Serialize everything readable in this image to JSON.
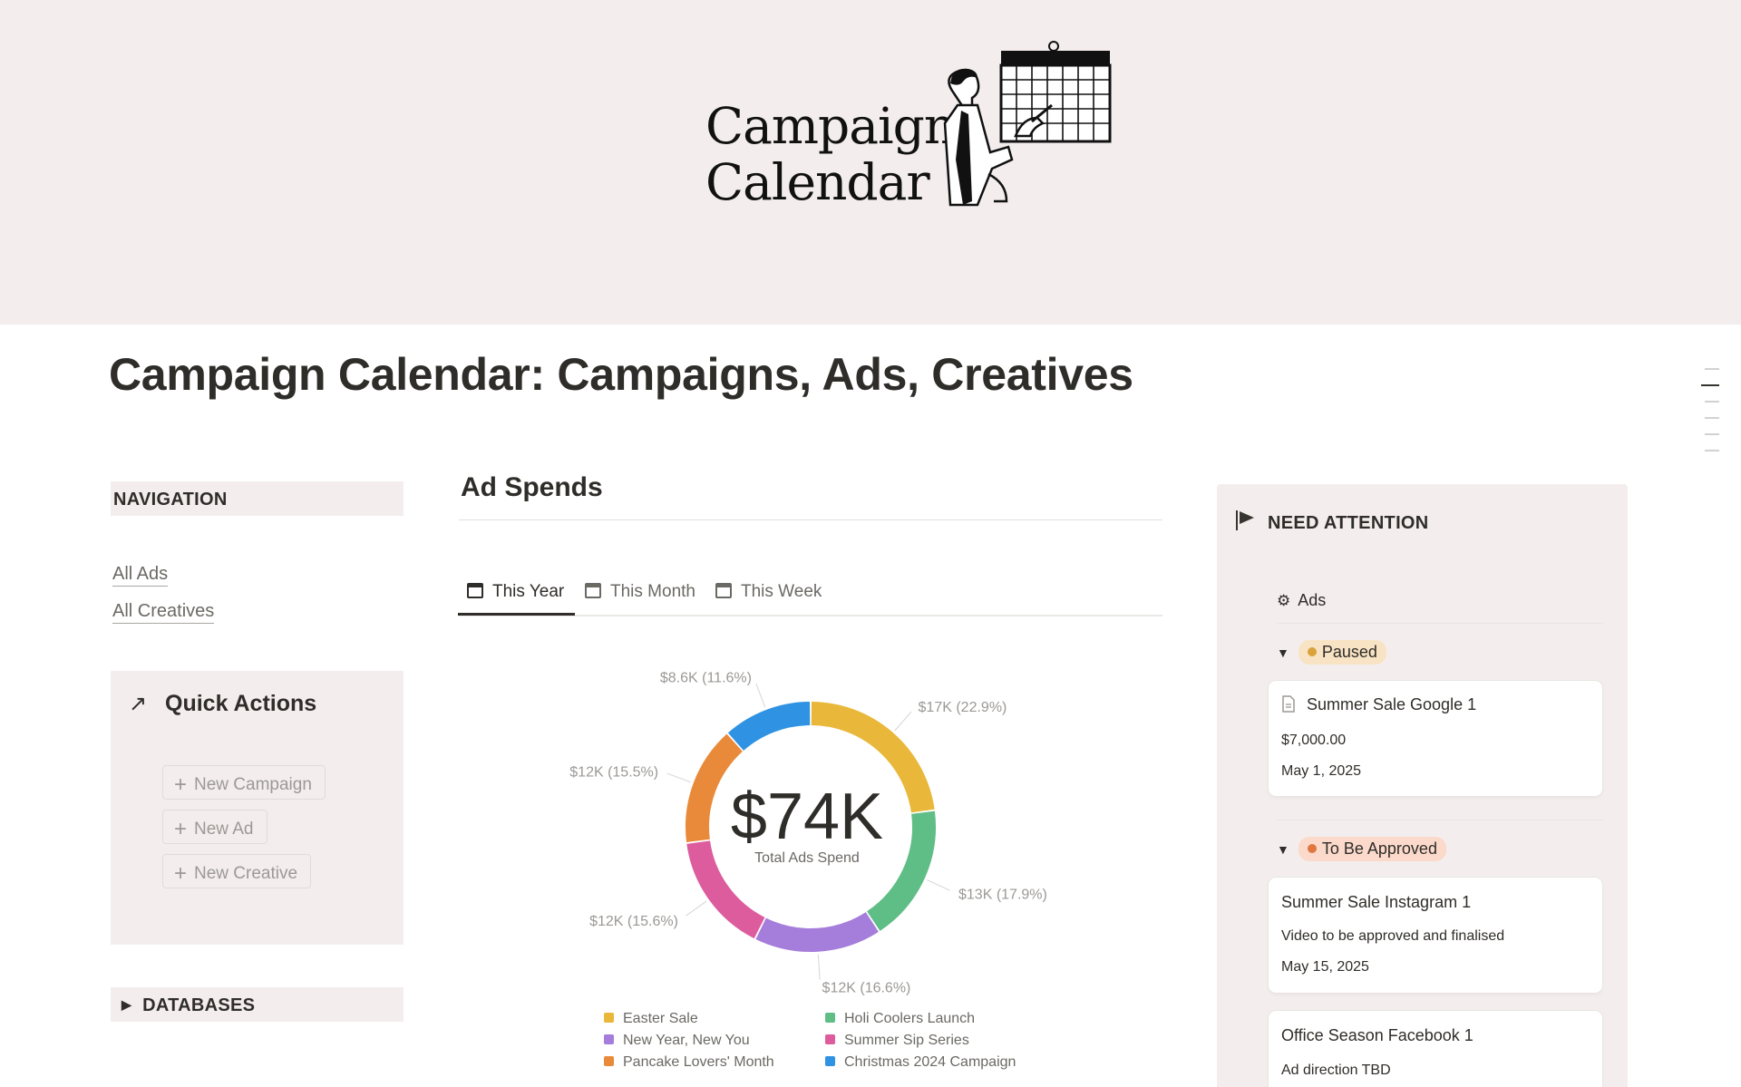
{
  "cover": {
    "title_line1": "Campaign",
    "title_line2": "Calendar"
  },
  "page_title": "Campaign Calendar: Campaigns, Ads, Creatives",
  "navigation": {
    "header": "NAVIGATION",
    "links": [
      "All Ads",
      "All Creatives"
    ]
  },
  "quick_actions": {
    "title": "Quick Actions",
    "buttons": [
      "New Campaign",
      "New Ad",
      "New Creative"
    ]
  },
  "databases": {
    "header": "DATABASES"
  },
  "ad_spends": {
    "title": "Ad Spends",
    "tabs": [
      "This Year",
      "This Month",
      "This Week"
    ],
    "active_tab": "This Year"
  },
  "chart_data": {
    "type": "pie",
    "center_value": "$74K",
    "center_label": "Total Ads Spend",
    "slices": [
      {
        "name": "Easter Sale",
        "label": "$17K (22.9%)",
        "value": 17,
        "percent": 22.9,
        "color": "#e9b83a"
      },
      {
        "name": "Holi Coolers Launch",
        "label": "$13K (17.9%)",
        "value": 13,
        "percent": 17.9,
        "color": "#5fbd86"
      },
      {
        "name": "New Year, New You",
        "label": "$12K (16.6%)",
        "value": 12,
        "percent": 16.6,
        "color": "#a57ddb"
      },
      {
        "name": "Summer Sip Series",
        "label": "$12K (15.6%)",
        "value": 12,
        "percent": 15.6,
        "color": "#dd5c9e"
      },
      {
        "name": "Pancake Lovers' Month",
        "label": "$12K (15.5%)",
        "value": 12,
        "percent": 15.5,
        "color": "#e98a3a"
      },
      {
        "name": "Christmas 2024 Campaign",
        "label": "$8.6K (11.6%)",
        "value": 8.6,
        "percent": 11.6,
        "color": "#2f92e2"
      }
    ],
    "legend": [
      {
        "name": "Easter Sale",
        "color": "#e9b83a"
      },
      {
        "name": "Holi Coolers Launch",
        "color": "#5fbd86"
      },
      {
        "name": "New Year, New You",
        "color": "#a57ddb"
      },
      {
        "name": "Summer Sip Series",
        "color": "#dd5c9e"
      },
      {
        "name": "Pancake Lovers' Month",
        "color": "#e98a3a"
      },
      {
        "name": "Christmas 2024 Campaign",
        "color": "#2f92e2"
      }
    ]
  },
  "need_attention": {
    "header": "NEED ATTENTION",
    "tab": "Ads",
    "groups": [
      {
        "status": "Paused",
        "badge_bg": "#f8e3c4",
        "dot_color": "#d9a23a",
        "cards": [
          {
            "title": "Summer Sale Google 1",
            "amount": "$7,000.00",
            "date": "May 1, 2025"
          }
        ]
      },
      {
        "status": "To Be Approved",
        "badge_bg": "#fbd9cb",
        "dot_color": "#e0773f",
        "cards": [
          {
            "title": "Summer Sale Instagram 1",
            "note": "Video to be approved and finalised",
            "date": "May 15, 2025"
          },
          {
            "title": "Office Season Facebook 1",
            "note": "Ad direction TBD"
          }
        ]
      }
    ]
  }
}
